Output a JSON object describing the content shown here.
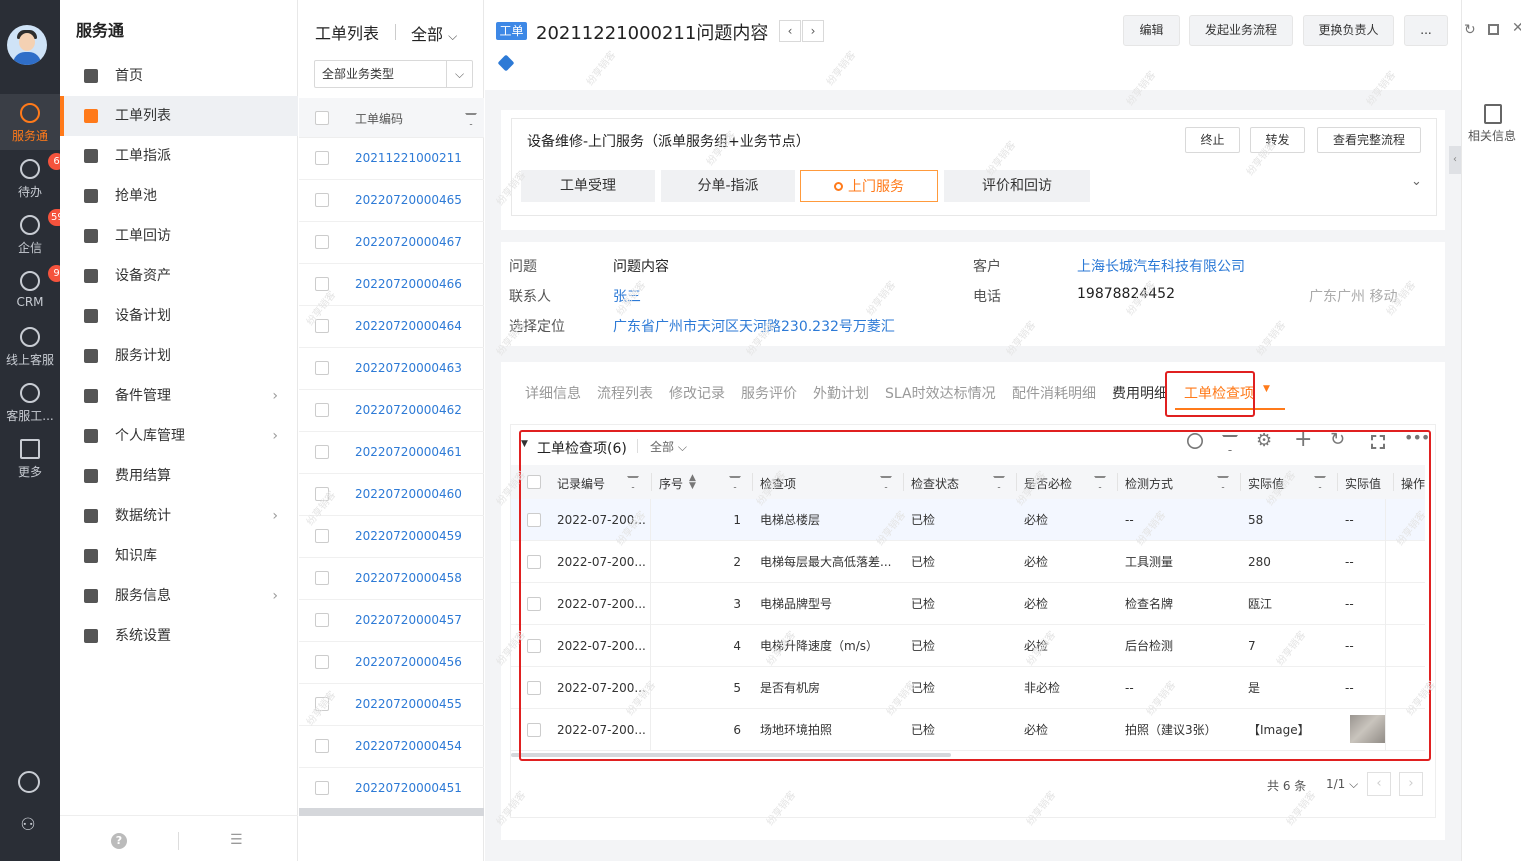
{
  "rail": {
    "items": [
      {
        "label": "服务通",
        "icon": "service-icon",
        "badge": ""
      },
      {
        "label": "待办",
        "icon": "todo-icon",
        "badge": "6"
      },
      {
        "label": "企信",
        "icon": "chat-icon",
        "badge": "59"
      },
      {
        "label": "CRM",
        "icon": "crm-icon",
        "badge": "9"
      },
      {
        "label": "线上客服",
        "icon": "online-service-icon",
        "badge": ""
      },
      {
        "label": "客服工...",
        "icon": "headset-icon",
        "badge": ""
      },
      {
        "label": "更多",
        "icon": "grid-icon",
        "badge": ""
      }
    ]
  },
  "menu": {
    "brand": "服务通",
    "items": [
      {
        "label": "首页",
        "icon": "home-icon",
        "arrow": false
      },
      {
        "label": "工单列表",
        "icon": "clipboard-icon",
        "arrow": false
      },
      {
        "label": "工单指派",
        "icon": "assign-icon",
        "arrow": false
      },
      {
        "label": "抢单池",
        "icon": "pool-icon",
        "arrow": false
      },
      {
        "label": "工单回访",
        "icon": "revisit-icon",
        "arrow": false
      },
      {
        "label": "设备资产",
        "icon": "device-icon",
        "arrow": false
      },
      {
        "label": "设备计划",
        "icon": "plan-icon",
        "arrow": false
      },
      {
        "label": "服务计划",
        "icon": "service-plan-icon",
        "arrow": false
      },
      {
        "label": "备件管理",
        "icon": "parts-icon",
        "arrow": true
      },
      {
        "label": "个人库管理",
        "icon": "personal-stock-icon",
        "arrow": true
      },
      {
        "label": "费用结算",
        "icon": "settlement-icon",
        "arrow": false
      },
      {
        "label": "数据统计",
        "icon": "stats-icon",
        "arrow": true
      },
      {
        "label": "知识库",
        "icon": "book-icon",
        "arrow": false
      },
      {
        "label": "服务信息",
        "icon": "info-icon",
        "arrow": true
      },
      {
        "label": "系统设置",
        "icon": "gear-icon",
        "arrow": false
      }
    ]
  },
  "list": {
    "title": "工单列表",
    "filter": "全部",
    "type_select": "全部业务类型",
    "column": "工单编码",
    "codes": [
      "20211221000211",
      "20220720000465",
      "20220720000467",
      "20220720000466",
      "20220720000464",
      "20220720000463",
      "20220720000462",
      "20220720000461",
      "20220720000460",
      "20220720000459",
      "20220720000458",
      "20220720000457",
      "20220720000456",
      "20220720000455",
      "20220720000454",
      "20220720000451"
    ]
  },
  "detail": {
    "tag": "工单",
    "title": "20211221000211问题内容",
    "buttons": [
      "编辑",
      "发起业务流程",
      "更换负责人",
      "..."
    ],
    "flow": {
      "name": "设备维修-上门服务（派单服务组+业务节点）",
      "buttons": [
        "终止",
        "转发",
        "查看完整流程"
      ],
      "steps": [
        "工单受理",
        "分单-指派",
        "上门服务",
        "评价和回访"
      ]
    },
    "info": {
      "issue_label": "问题",
      "issue": "问题内容",
      "customer_label": "客户",
      "customer": "上海长城汽车科技有限公司",
      "contact_label": "联系人",
      "contact": "张三",
      "phone_label": "电话",
      "phone": "19878824452",
      "carrier": "广东广州 移动",
      "location_label": "选择定位",
      "location": "广东省广州市天河区天河路230.232号万菱汇"
    },
    "tabs": [
      "详细信息",
      "流程列表",
      "修改记录",
      "服务评价",
      "外勤计划",
      "SLA时效达标情况",
      "配件消耗明细",
      "费用明细",
      "工单检查项"
    ],
    "table": {
      "title": "工单检查项(6)",
      "filter": "全部",
      "columns": [
        "记录编号",
        "序号",
        "检查项",
        "检查状态",
        "是否必检",
        "检测方式",
        "实际值",
        "实际值",
        "操作"
      ],
      "rows": [
        {
          "record": "2022-07-200...",
          "seq": "1",
          "item": "电梯总楼层",
          "status": "已检",
          "required": "必检",
          "method": "--",
          "actual": "58",
          "actual2": "--"
        },
        {
          "record": "2022-07-200...",
          "seq": "2",
          "item": "电梯每层最大高低落差...",
          "status": "已检",
          "required": "必检",
          "method": "工具测量",
          "actual": "280",
          "actual2": "--"
        },
        {
          "record": "2022-07-200...",
          "seq": "3",
          "item": "电梯品牌型号",
          "status": "已检",
          "required": "必检",
          "method": "检查名牌",
          "actual": "瓯江",
          "actual2": "--"
        },
        {
          "record": "2022-07-200...",
          "seq": "4",
          "item": "电梯升降速度（m/s）",
          "status": "已检",
          "required": "必检",
          "method": "后台检测",
          "actual": "7",
          "actual2": "--"
        },
        {
          "record": "2022-07-200...",
          "seq": "5",
          "item": "是否有机房",
          "status": "已检",
          "required": "非必检",
          "method": "--",
          "actual": "是",
          "actual2": "--"
        },
        {
          "record": "2022-07-200...",
          "seq": "6",
          "item": "场地环境拍照",
          "status": "已检",
          "required": "必检",
          "method": "拍照（建议3张）",
          "actual": "【Image】",
          "actual2": ""
        }
      ],
      "total": "共 6 条",
      "page": "1/1"
    }
  },
  "side": {
    "related": "相关信息"
  },
  "watermark": "纷享销客"
}
